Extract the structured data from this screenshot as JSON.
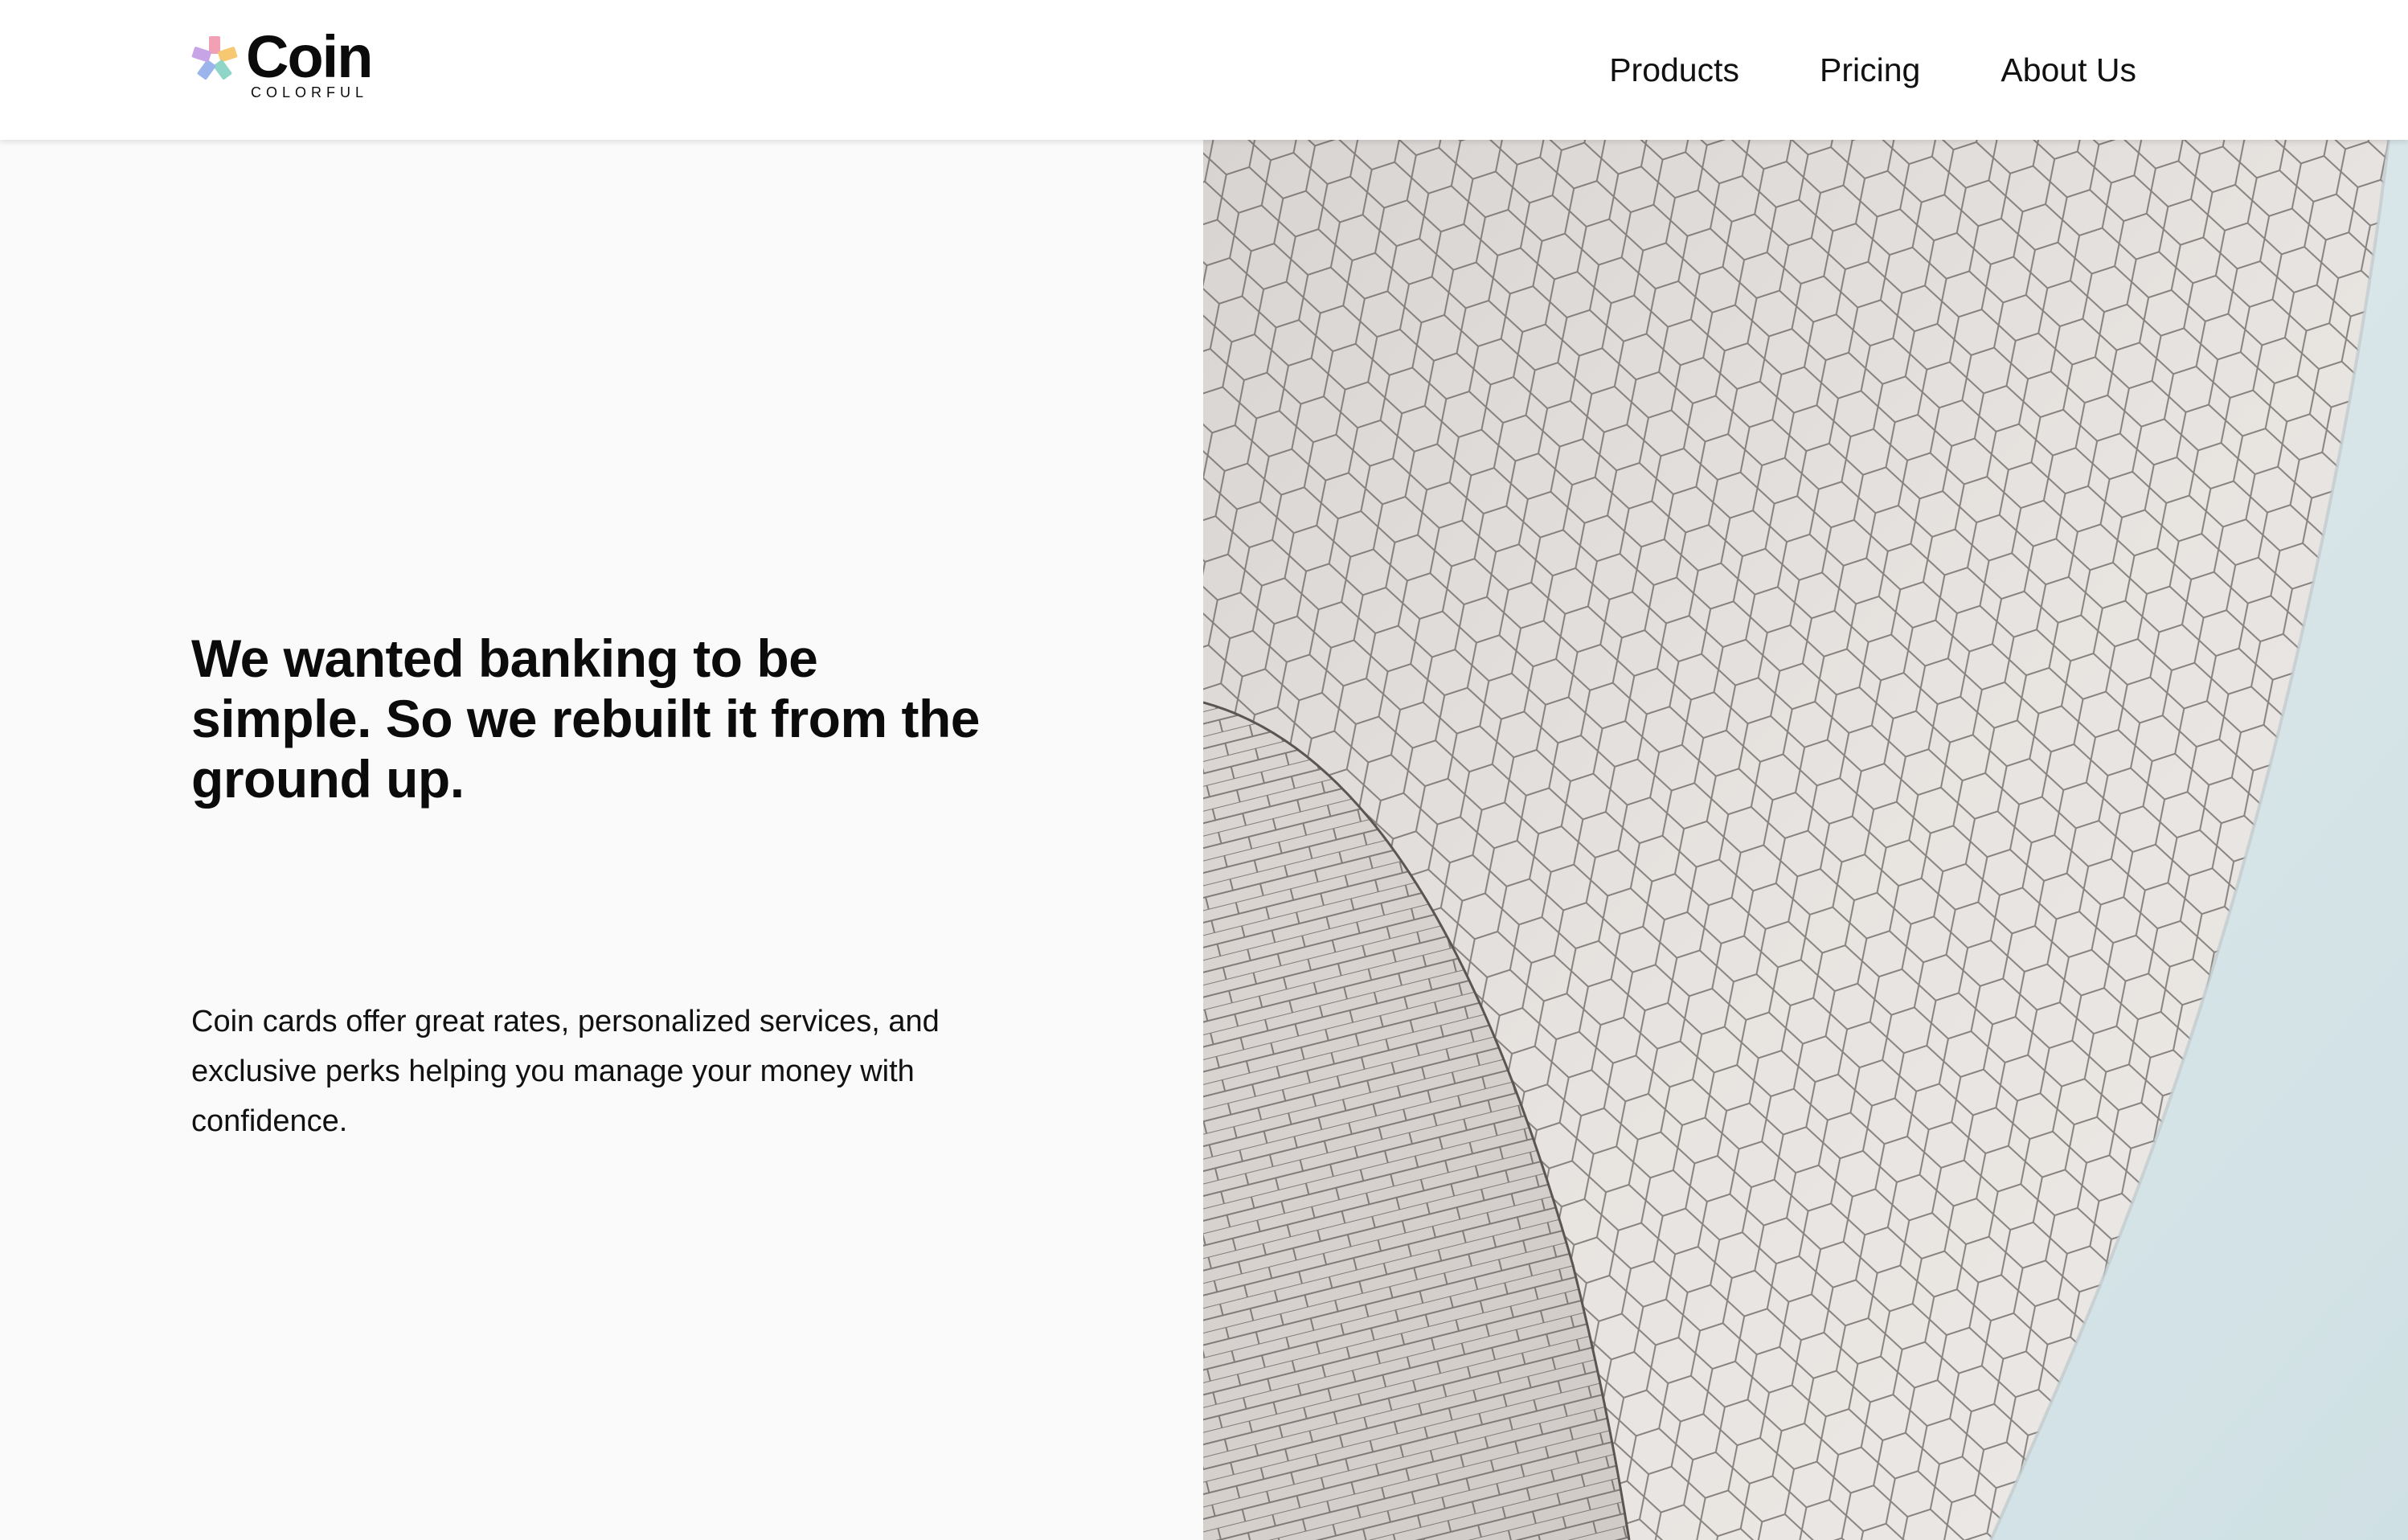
{
  "brand": {
    "name": "Coin",
    "tagline": "COLORFUL",
    "logo_colors": [
      "#f2a0b3",
      "#f7c872",
      "#8fd6c9",
      "#9bb5ec",
      "#c7a4e6"
    ]
  },
  "nav": {
    "items": [
      {
        "label": "Products"
      },
      {
        "label": "Pricing"
      },
      {
        "label": "About Us"
      }
    ]
  },
  "hero": {
    "title": "We wanted banking to be simple. So we rebuilt it from the ground up.",
    "body": "Coin cards offer great rates, personalized services, and exclusive perks helping you manage your money with confidence."
  },
  "image": {
    "icon": "tiled-building-facade-photo",
    "sky_color": "#d3e4e7",
    "facade_color": "#e6e2df",
    "grout_color": "#6e6a68"
  }
}
